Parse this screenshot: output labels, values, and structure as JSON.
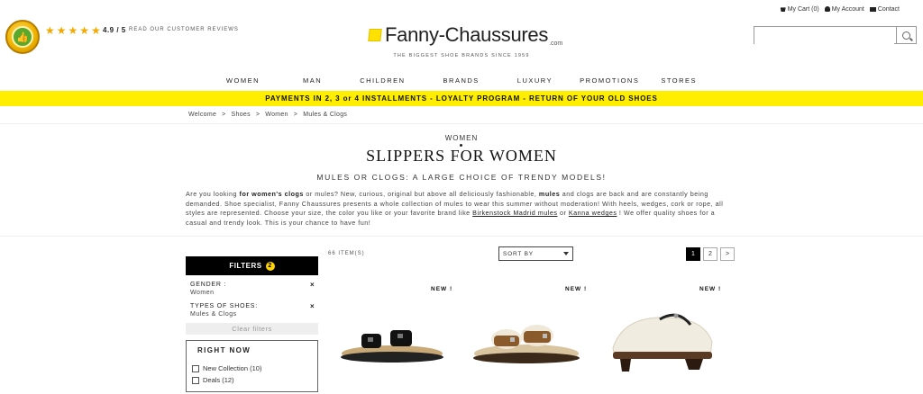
{
  "header": {
    "badge": {
      "label": "CLIENT SATISFAIT"
    },
    "stars": "★★★★★",
    "rating": "4.9 / 5",
    "reviews_link": "READ OUR CUSTOMER REVIEWS",
    "logo_text": "Fanny-Chaussures",
    "logo_suffix": ".com",
    "tagline": "THE BIGGEST SHOE BRANDS SINCE 1959",
    "links": {
      "cart": "My Cart (0)",
      "account": "My Account",
      "contact": "Contact"
    },
    "search": {
      "placeholder": "",
      "value": ""
    }
  },
  "nav": [
    "WOMEN",
    "MAN",
    "CHILDREN",
    "BRANDS",
    "LUXURY",
    "PROMOTIONS",
    "STORES"
  ],
  "promo": "PAYMENTS IN 2, 3 or 4 INSTALLMENTS - LOYALTY PROGRAM - RETURN OF YOUR OLD SHOES",
  "breadcrumb": [
    "Welcome",
    ">",
    "Shoes",
    ">",
    "Women",
    ">",
    "Mules & Clogs"
  ],
  "category": {
    "parent": "WOMEN",
    "title": "SLIPPERS FOR WOMEN",
    "subtitle": "MULES OR CLOGS: A LARGE CHOICE OF TRENDY MODELS!",
    "description": {
      "p1": "Are you looking ",
      "b1": "for women's clogs",
      "p2": "  or mules? New, curious, original but above all deliciously fashionable, ",
      "b2": "mules",
      "p3": " and clogs are back and are constantly being demanded. Shoe specialist, Fanny Chaussures presents a whole collection of mules to wear this summer without moderation! With heels, wedges, cork or rope, all styles are represented. Choose your size, the color you like or your favorite brand like ",
      "link1": "Birkenstock Madrid mules",
      "p4": " or ",
      "link2": "Kanna wedges",
      "p5": " ! We offer quality shoes for a casual and trendy look. This is your chance to have fun!"
    }
  },
  "filters": {
    "title": "FILTERS",
    "count": "2",
    "active": [
      {
        "label": "GENDER :",
        "value": "Women",
        "remove": "×"
      },
      {
        "label": "TYPES OF SHOES:",
        "value": "Mules & Clogs",
        "remove": "×"
      }
    ],
    "clear": "Clear filters",
    "right_now": {
      "title": "RIGHT NOW",
      "options": [
        "New Collection (10)",
        "Deals (12)"
      ]
    }
  },
  "listing": {
    "item_count": "66 ITEM(S)",
    "sort_label": "SORT BY",
    "pages": [
      "1",
      "2",
      ">"
    ],
    "products": [
      {
        "badge": "NEW !",
        "color": "#111111"
      },
      {
        "badge": "NEW !",
        "color": "#8a5a2b"
      },
      {
        "badge": "NEW !",
        "color": "#f1ece0"
      }
    ]
  }
}
